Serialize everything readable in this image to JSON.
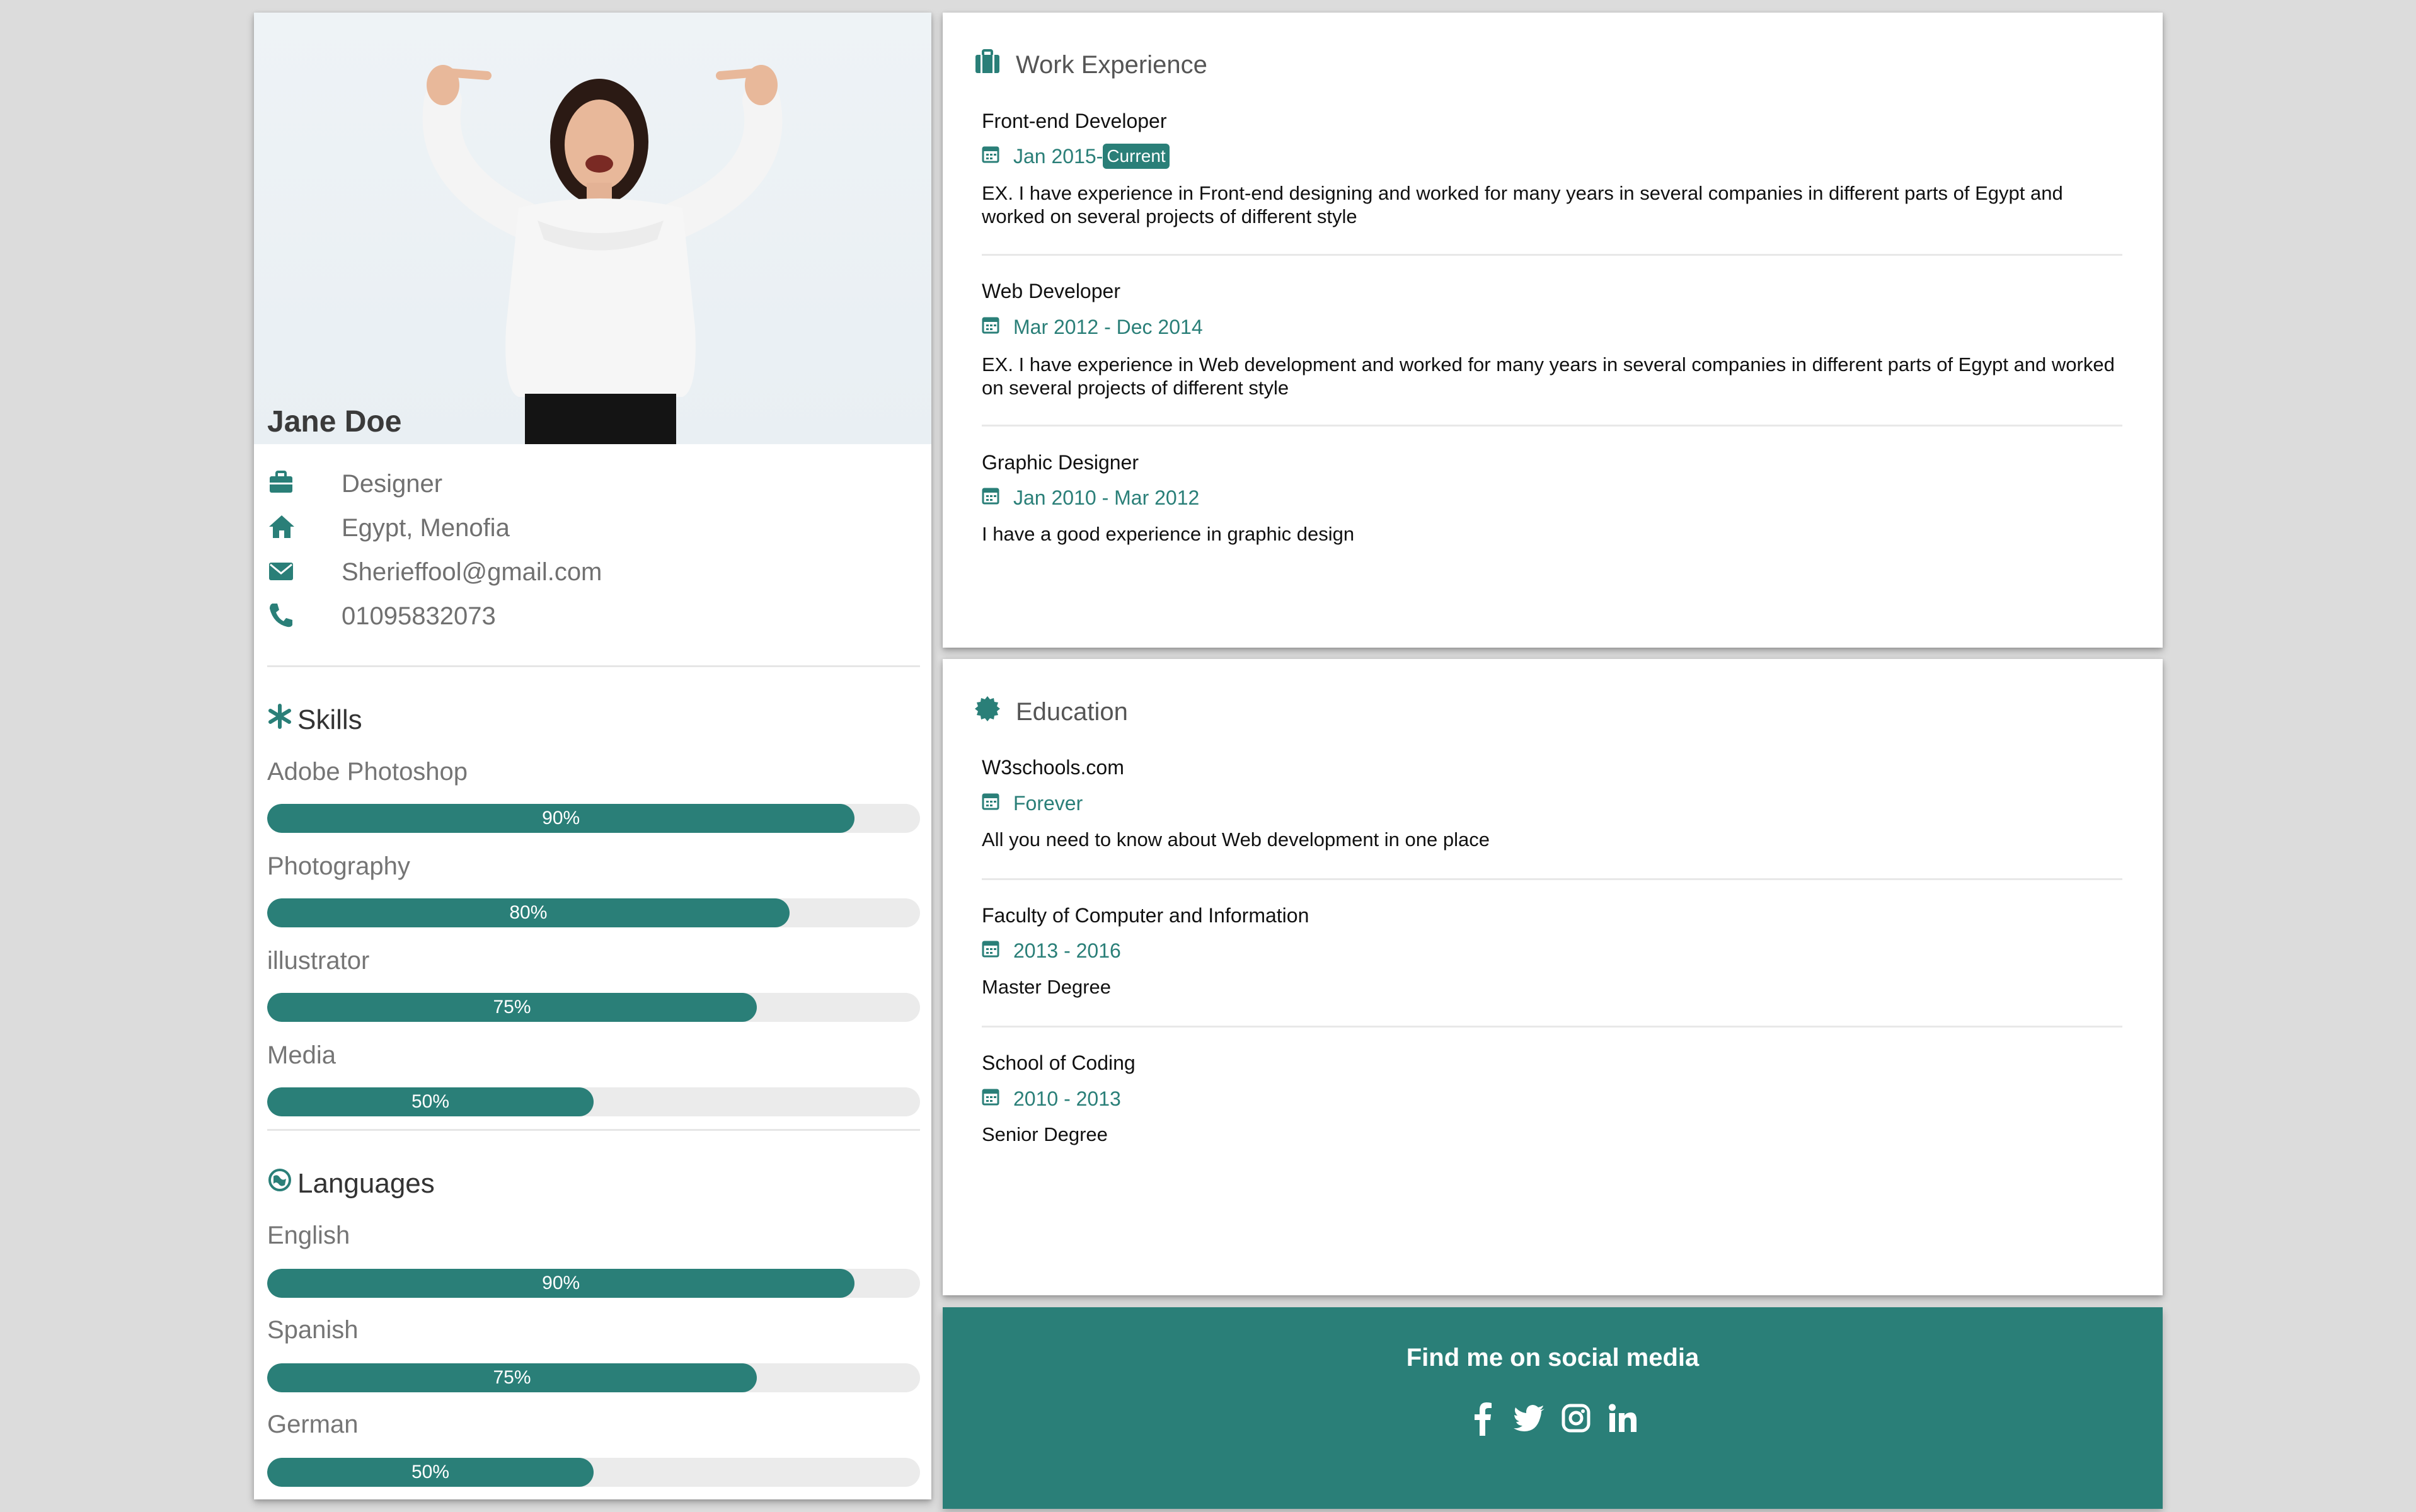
{
  "profile": {
    "name": "Jane Doe",
    "job": "Designer",
    "location": "Egypt, Menofia",
    "email": "Sherieffool@gmail.com",
    "phone": "01095832073"
  },
  "skills": {
    "title": "Skills",
    "items": [
      {
        "label": "Adobe Photoshop",
        "percent": 90,
        "percent_text": "90%"
      },
      {
        "label": "Photography",
        "percent": 80,
        "percent_text": "80%"
      },
      {
        "label": "illustrator",
        "percent": 75,
        "percent_text": "75%"
      },
      {
        "label": "Media",
        "percent": 50,
        "percent_text": "50%"
      }
    ]
  },
  "languages": {
    "title": "Languages",
    "items": [
      {
        "label": "English",
        "percent": 90,
        "percent_text": "90%"
      },
      {
        "label": "Spanish",
        "percent": 75,
        "percent_text": "75%"
      },
      {
        "label": "German",
        "percent": 50,
        "percent_text": "50%"
      }
    ]
  },
  "work": {
    "title": "Work Experience",
    "entries": [
      {
        "title": "Front-end Developer",
        "date": "Jan 2015-",
        "tag": "Current",
        "desc": "EX. I have experience in Front-end designing and worked for many years in several companies in different parts of Egypt and worked on several projects of different style"
      },
      {
        "title": "Web Developer",
        "date": "Mar 2012 - Dec 2014",
        "desc": "EX. I have experience in Web development and worked for many years in several companies in different parts of Egypt and worked on several projects of different style"
      },
      {
        "title": "Graphic Designer",
        "date": "Jan 2010 - Mar 2012",
        "desc": "I have a good experience in graphic design"
      }
    ]
  },
  "education": {
    "title": "Education",
    "entries": [
      {
        "title": "W3schools.com",
        "date": "Forever",
        "desc": "All you need to know about Web development in one place"
      },
      {
        "title": "Faculty of Computer and Information",
        "date": "2013 - 2016",
        "desc": "Master Degree"
      },
      {
        "title": "School of Coding",
        "date": "2010 - 2013",
        "desc": "Senior Degree"
      }
    ]
  },
  "social": {
    "title": "Find me on social media",
    "icons": [
      "facebook-icon",
      "twitter-icon",
      "instagram-icon",
      "linkedin-icon"
    ]
  },
  "colors": {
    "accent": "#2a7f78",
    "background": "#dcdcdc",
    "track": "#ebebeb"
  }
}
